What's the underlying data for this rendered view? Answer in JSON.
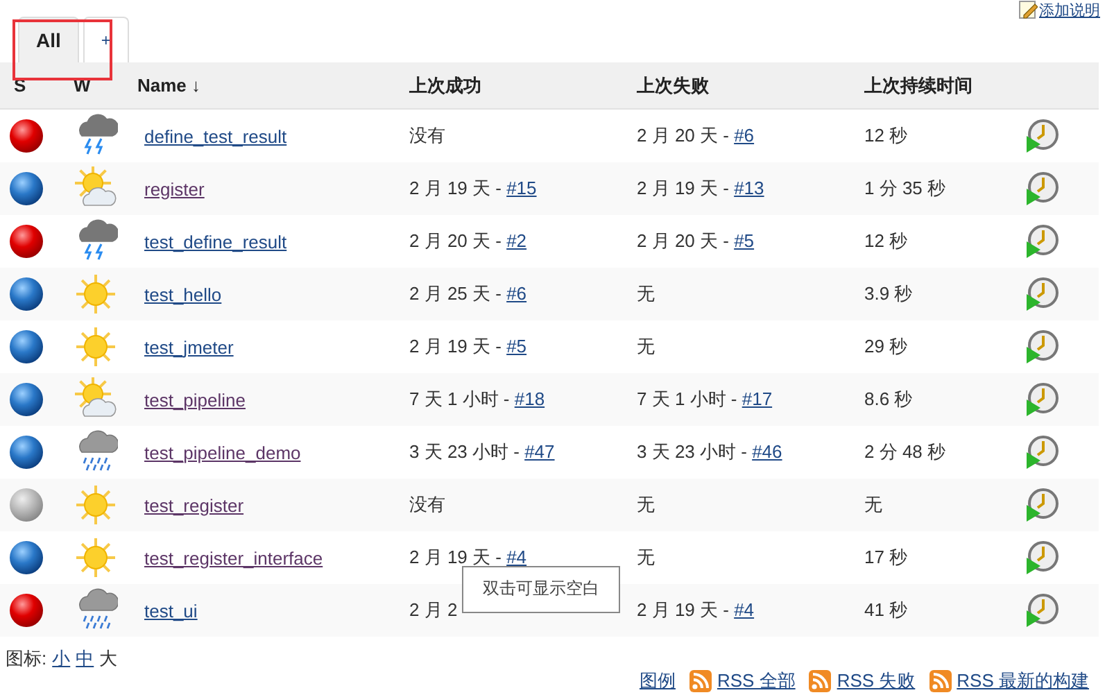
{
  "description_link": "添加说明",
  "tabs": [
    {
      "label": "All",
      "selected": true
    },
    {
      "label": "+",
      "selected": false
    }
  ],
  "columns": [
    "S",
    "W",
    "Name ↓",
    "上次成功",
    "上次失败",
    "上次持续时间"
  ],
  "jobs": [
    {
      "status": {
        "kind": "failed"
      },
      "weather": {
        "kind": "storm"
      },
      "name": "define_test_result",
      "visited": false,
      "last_success": {
        "text": "没有"
      },
      "last_failure": {
        "text": "2 月 20 天 - ",
        "link": "#6"
      },
      "duration": "12 秒"
    },
    {
      "status": {
        "kind": "success"
      },
      "weather": {
        "kind": "cloudy-sun"
      },
      "name": "register",
      "visited": true,
      "last_success": {
        "text": "2 月 19 天 - ",
        "link": "#15"
      },
      "last_failure": {
        "text": "2 月 19 天 - ",
        "link": "#13"
      },
      "duration": "1 分 35 秒"
    },
    {
      "status": {
        "kind": "failed"
      },
      "weather": {
        "kind": "storm"
      },
      "name": "test_define_result",
      "visited": false,
      "last_success": {
        "text": "2 月 20 天 - ",
        "link": "#2"
      },
      "last_failure": {
        "text": "2 月 20 天 - ",
        "link": "#5"
      },
      "duration": "12 秒"
    },
    {
      "status": {
        "kind": "success"
      },
      "weather": {
        "kind": "sun"
      },
      "name": "test_hello",
      "visited": false,
      "last_success": {
        "text": "2 月 25 天 - ",
        "link": "#6"
      },
      "last_failure": {
        "text": "无"
      },
      "duration": "3.9 秒"
    },
    {
      "status": {
        "kind": "success"
      },
      "weather": {
        "kind": "sun"
      },
      "name": "test_jmeter",
      "visited": false,
      "last_success": {
        "text": "2 月 19 天 - ",
        "link": "#5"
      },
      "last_failure": {
        "text": "无"
      },
      "duration": "29 秒"
    },
    {
      "status": {
        "kind": "success"
      },
      "weather": {
        "kind": "cloudy-sun"
      },
      "name": "test_pipeline",
      "visited": true,
      "last_success": {
        "text": "7 天 1 小时 - ",
        "link": "#18"
      },
      "last_failure": {
        "text": "7 天 1 小时 - ",
        "link": "#17"
      },
      "duration": "8.6 秒"
    },
    {
      "status": {
        "kind": "success"
      },
      "weather": {
        "kind": "rain"
      },
      "name": "test_pipeline_demo",
      "visited": true,
      "last_success": {
        "text": "3 天 23 小时 - ",
        "link": "#47"
      },
      "last_failure": {
        "text": "3 天 23 小时 - ",
        "link": "#46"
      },
      "duration": "2 分 48 秒"
    },
    {
      "status": {
        "kind": "disabled"
      },
      "weather": {
        "kind": "sun"
      },
      "name": "test_register",
      "visited": true,
      "last_success": {
        "text": "没有"
      },
      "last_failure": {
        "text": "无"
      },
      "duration": "无"
    },
    {
      "status": {
        "kind": "success"
      },
      "weather": {
        "kind": "sun"
      },
      "name": "test_register_interface",
      "visited": true,
      "last_success": {
        "text": "2 月 19 天 - ",
        "link": "#4"
      },
      "last_failure": {
        "text": "无"
      },
      "duration": "17 秒"
    },
    {
      "status": {
        "kind": "failed"
      },
      "weather": {
        "kind": "rain"
      },
      "name": "test_ui",
      "visited": false,
      "last_success": {
        "text": "2 月 2"
      },
      "last_failure": {
        "text": "2 月 19 天 - ",
        "link": "#4"
      },
      "duration": "41 秒"
    }
  ],
  "tooltip": "双击可显示空白",
  "icon_size": {
    "label": "图标:",
    "sizes": [
      "小",
      "中",
      "大"
    ]
  },
  "footer_links": [
    {
      "kind": "legend",
      "label": "图例"
    },
    {
      "kind": "rss",
      "label": "RSS 全部"
    },
    {
      "kind": "rss",
      "label": "RSS 失败"
    },
    {
      "kind": "rss",
      "label": "RSS 最新的构建"
    }
  ]
}
